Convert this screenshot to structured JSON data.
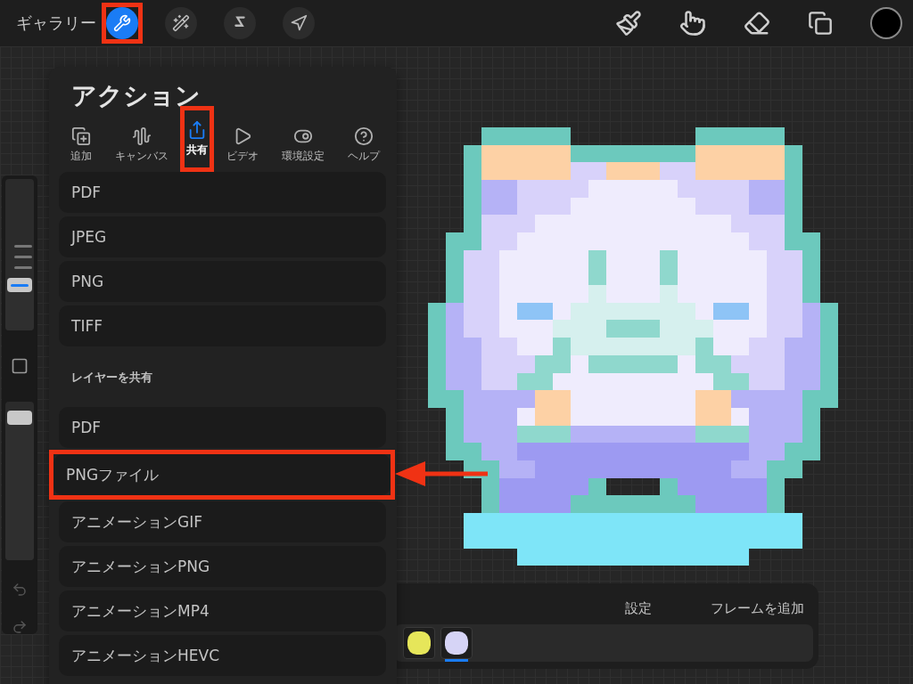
{
  "top_bar": {
    "gallery": "ギャラリー",
    "tools": [
      {
        "selected": true,
        "highlighted": true
      },
      {
        "selected": false,
        "highlighted": false
      },
      {
        "selected": false,
        "highlighted": false
      },
      {
        "selected": false,
        "highlighted": false
      }
    ]
  },
  "sidebar": {
    "brush_size": {
      "level": 0.3
    },
    "opacity": {
      "level": 0.9
    }
  },
  "actions": {
    "title": "アクション",
    "tabs": [
      {
        "label": "追加",
        "selected": false,
        "highlighted": false
      },
      {
        "label": "キャンバス",
        "selected": false,
        "highlighted": false
      },
      {
        "label": "共有",
        "selected": true,
        "highlighted": true
      },
      {
        "label": "ビデオ",
        "selected": false,
        "highlighted": false
      },
      {
        "label": "環境設定",
        "selected": false,
        "highlighted": false
      },
      {
        "label": "ヘルプ",
        "selected": false,
        "highlighted": false
      }
    ],
    "image_formats": [
      "PDF",
      "JPEG",
      "PNG",
      "TIFF"
    ],
    "layer_section": "レイヤーを共有",
    "layer_formats": [
      {
        "label": "PDF",
        "highlighted": false
      },
      {
        "label": "PNGファイル",
        "highlighted": true
      },
      {
        "label": "アニメーションGIF",
        "highlighted": false
      },
      {
        "label": "アニメーションPNG",
        "highlighted": false
      },
      {
        "label": "アニメーションMP4",
        "highlighted": false
      },
      {
        "label": "アニメーションHEVC",
        "highlighted": false
      }
    ]
  },
  "animation_bar": {
    "settings": "設定",
    "add_frame": "フレームを追加",
    "frames": [
      {
        "color": "#e6e65a",
        "selected": false
      },
      {
        "color": "#d6d4f6",
        "selected": true
      }
    ]
  }
}
